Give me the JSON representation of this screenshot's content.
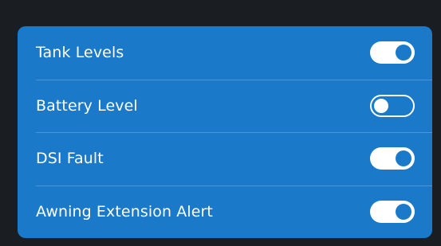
{
  "colors": {
    "background": "#1a1d22",
    "panel": "#1a79c9",
    "text": "#ffffff"
  },
  "settings": [
    {
      "label": "Tank Levels",
      "enabled": true
    },
    {
      "label": "Battery Level",
      "enabled": false
    },
    {
      "label": "DSI Fault",
      "enabled": true
    },
    {
      "label": "Awning Extension Alert",
      "enabled": true
    }
  ]
}
